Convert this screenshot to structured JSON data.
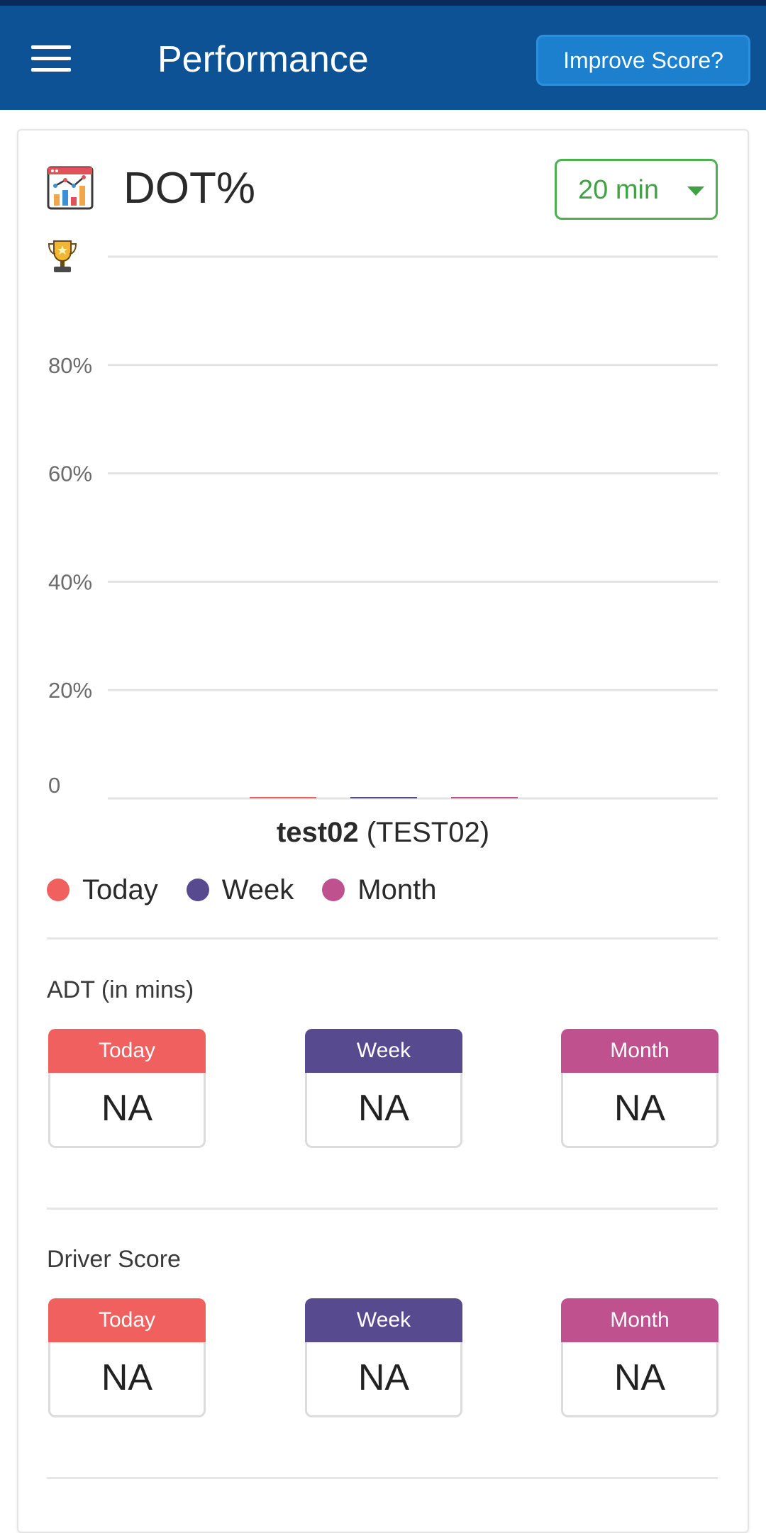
{
  "header": {
    "title": "Performance",
    "improve_label": "Improve Score?",
    "background": "#0c5294"
  },
  "dot_card": {
    "title": "DOT%",
    "time_select": {
      "selected": "20 min"
    }
  },
  "chart_data": {
    "type": "bar",
    "categories": [
      "test02 (TEST02)"
    ],
    "series": [
      {
        "name": "Today",
        "color": "#f0605f",
        "values": [
          0
        ]
      },
      {
        "name": "Week",
        "color": "#584a8f",
        "values": [
          0
        ]
      },
      {
        "name": "Month",
        "color": "#c0518f",
        "values": [
          0
        ]
      }
    ],
    "y_ticks": [
      "0",
      "20%",
      "40%",
      "60%",
      "80%"
    ],
    "ylim": [
      0,
      100
    ],
    "grid": true,
    "legend": "bottom-left",
    "x_label_bold": "test02",
    "x_label_rest": "(TEST02)"
  },
  "legend": [
    {
      "label": "Today",
      "color": "#f0605f"
    },
    {
      "label": "Week",
      "color": "#584a8f"
    },
    {
      "label": "Month",
      "color": "#c0518f"
    }
  ],
  "adt": {
    "label": "ADT (in mins)",
    "items": [
      {
        "period": "Today",
        "value": "NA",
        "color": "#f0605f"
      },
      {
        "period": "Week",
        "value": "NA",
        "color": "#584a8f"
      },
      {
        "period": "Month",
        "value": "NA",
        "color": "#c0518f"
      }
    ]
  },
  "driver_score": {
    "label": "Driver Score",
    "items": [
      {
        "period": "Today",
        "value": "NA",
        "color": "#f0605f"
      },
      {
        "period": "Week",
        "value": "NA",
        "color": "#584a8f"
      },
      {
        "period": "Month",
        "value": "NA",
        "color": "#c0518f"
      }
    ]
  }
}
